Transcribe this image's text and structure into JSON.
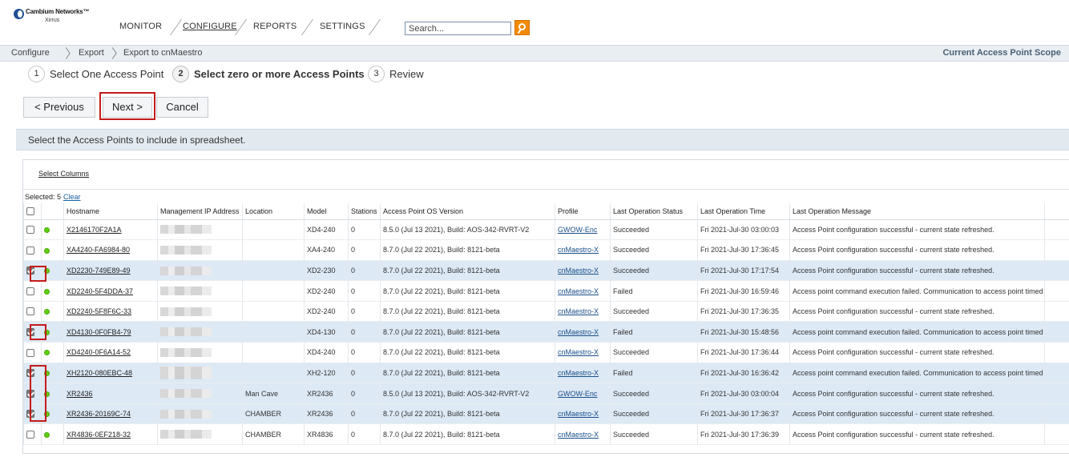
{
  "brand": {
    "name": "Cambium Networks",
    "trademark": "™",
    "sub": "Xirrus",
    "mark_color": "#1d4f91"
  },
  "nav": {
    "items": [
      "MONITOR",
      "CONFIGURE",
      "REPORTS",
      "SETTINGS"
    ],
    "active": "CONFIGURE",
    "search_placeholder": "Search...",
    "search_button_color": "#f28b00"
  },
  "breadcrumb": [
    "Configure",
    "Export",
    "Export to cnMaestro"
  ],
  "scope_label": "Current Access Point Scope",
  "steps": [
    {
      "num": "1",
      "label": "Select One Access Point",
      "current": false
    },
    {
      "num": "2",
      "label": "Select zero or more Access Points",
      "current": true
    },
    {
      "num": "3",
      "label": "Review",
      "current": false
    }
  ],
  "buttons": {
    "previous": "< Previous",
    "next": "Next >",
    "cancel": "Cancel"
  },
  "instruction": "Select the Access Points to include in spreadsheet.",
  "grid": {
    "select_columns": "Select Columns",
    "selected_label": "Selected: 5",
    "clear_label": "Clear",
    "columns": [
      "Hostname",
      "Management IP Address",
      "Location",
      "Model",
      "Stations",
      "Access Point OS Version",
      "Profile",
      "Last Operation Status",
      "Last Operation Time",
      "Last Operation Message"
    ],
    "rows": [
      {
        "selected": false,
        "hostname": "X2146170F2A1A",
        "location": "",
        "model": "XD4-240",
        "stations": "0",
        "os": "8.5.0 (Jul 13 2021), Build: AOS-342-RVRT-V2",
        "profile": "GWOW-Enc",
        "status": "Succeeded",
        "time": "Fri 2021-Jul-30 03:00:03",
        "message": "Access Point configuration successful - current state refreshed."
      },
      {
        "selected": false,
        "hostname": "XA4240-FA6984-80",
        "location": "",
        "model": "XA4-240",
        "stations": "0",
        "os": "8.7.0 (Jul 22 2021), Build: 8121-beta",
        "profile": "cnMaestro-X",
        "status": "Succeeded",
        "time": "Fri 2021-Jul-30 17:36:45",
        "message": "Access Point configuration successful - current state refreshed."
      },
      {
        "selected": true,
        "hostname": "XD2230-749E89-49",
        "location": "",
        "model": "XD2-230",
        "stations": "0",
        "os": "8.7.0 (Jul 22 2021), Build: 8121-beta",
        "profile": "cnMaestro-X",
        "status": "Succeeded",
        "time": "Fri 2021-Jul-30 17:17:54",
        "message": "Access Point configuration successful - current state refreshed."
      },
      {
        "selected": false,
        "hostname": "XD2240-5F4DDA-37",
        "location": "",
        "model": "XD2-240",
        "stations": "0",
        "os": "8.7.0 (Jul 22 2021), Build: 8121-beta",
        "profile": "cnMaestro-X",
        "status": "Failed",
        "time": "Fri 2021-Jul-30 16:59:46",
        "message": "Access point command execution failed. Communication to access point timed out."
      },
      {
        "selected": false,
        "hostname": "XD2240-5F8F6C-33",
        "location": "",
        "model": "XD2-240",
        "stations": "0",
        "os": "8.7.0 (Jul 22 2021), Build: 8121-beta",
        "profile": "cnMaestro-X",
        "status": "Succeeded",
        "time": "Fri 2021-Jul-30 17:36:35",
        "message": "Access Point configuration successful - current state refreshed."
      },
      {
        "selected": true,
        "hostname": "XD4130-0F0FB4-79",
        "location": "",
        "model": "XD4-130",
        "stations": "0",
        "os": "8.7.0 (Jul 22 2021), Build: 8121-beta",
        "profile": "cnMaestro-X",
        "status": "Failed",
        "time": "Fri 2021-Jul-30 15:48:56",
        "message": "Access point command execution failed. Communication to access point timed out."
      },
      {
        "selected": false,
        "hostname": "XD4240-0F6A14-52",
        "location": "",
        "model": "XD4-240",
        "stations": "0",
        "os": "8.7.0 (Jul 22 2021), Build: 8121-beta",
        "profile": "cnMaestro-X",
        "status": "Succeeded",
        "time": "Fri 2021-Jul-30 17:36:44",
        "message": "Access Point configuration successful - current state refreshed."
      },
      {
        "selected": true,
        "hostname": "XH2120-080EBC-48",
        "location": "",
        "model": "XH2-120",
        "stations": "0",
        "os": "8.7.0 (Jul 22 2021), Build: 8121-beta",
        "profile": "cnMaestro-X",
        "status": "Failed",
        "time": "Fri 2021-Jul-30 16:36:42",
        "message": "Access point command execution failed. Communication to access point timed out."
      },
      {
        "selected": true,
        "hostname": "XR2436",
        "location": "Man Cave",
        "model": "XR2436",
        "stations": "0",
        "os": "8.5.0 (Jul 13 2021), Build: AOS-342-RVRT-V2",
        "profile": "GWOW-Enc",
        "status": "Succeeded",
        "time": "Fri 2021-Jul-30 03:00:04",
        "message": "Access Point configuration successful - current state refreshed."
      },
      {
        "selected": true,
        "hostname": "XR2436-20169C-74",
        "location": "CHAMBER",
        "model": "XR2436",
        "stations": "0",
        "os": "8.7.0 (Jul 22 2021), Build: 8121-beta",
        "profile": "cnMaestro-X",
        "status": "Succeeded",
        "time": "Fri 2021-Jul-30 17:36:37",
        "message": "Access Point configuration successful - current state refreshed."
      },
      {
        "selected": false,
        "hostname": "XR4836-0EF218-32",
        "location": "CHAMBER",
        "model": "XR4836",
        "stations": "0",
        "os": "8.7.0 (Jul 22 2021), Build: 8121-beta",
        "profile": "cnMaestro-X",
        "status": "Succeeded",
        "time": "Fri 2021-Jul-30 17:36:39",
        "message": "Access Point configuration successful - current state refreshed."
      }
    ]
  },
  "colors": {
    "selected_row": "#dde9f5",
    "online_dot": "#5fd00e",
    "highlight_box": "#c41b1b"
  }
}
